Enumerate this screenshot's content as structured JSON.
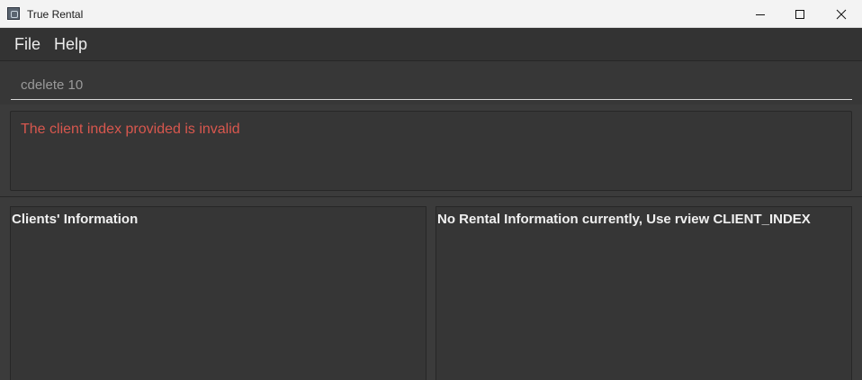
{
  "window": {
    "title": "True Rental",
    "icon": "app-icon",
    "controls": [
      "minimize-icon",
      "maximize-icon",
      "close-icon"
    ]
  },
  "menu": {
    "items": [
      {
        "label": "File"
      },
      {
        "label": "Help"
      }
    ]
  },
  "command": {
    "value": "cdelete 10"
  },
  "result": {
    "message": "The client index provided is invalid",
    "color": "#d8574e"
  },
  "clients_panel": {
    "title": "Clients' Information"
  },
  "rental_panel": {
    "title": "No Rental Information currently, Use rview CLIENT_INDEX"
  }
}
